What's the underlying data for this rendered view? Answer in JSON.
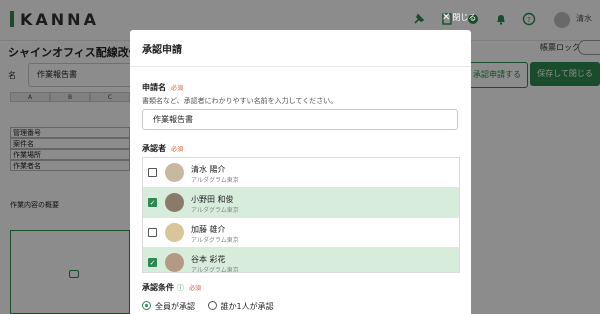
{
  "app": {
    "logo": "KANNA",
    "user_short": "清水",
    "close_label": "閉じる"
  },
  "background": {
    "project_title": "シャインオフィス配線改修工",
    "board_lock_label": "帳票ロック",
    "name_label": "名",
    "name_value": "作業報告書",
    "approval_button": "承認申請する",
    "save_close_button": "保存して閉じる",
    "sheet_columns": [
      "A",
      "B",
      "C"
    ],
    "sheet_rows": [
      "管理番号",
      "案件名",
      "作業場所",
      "作業者名"
    ],
    "sheet_text": "作業内容の概要"
  },
  "modal": {
    "title": "承認申請",
    "request_name": {
      "label": "申請名",
      "required": "必須",
      "description": "書類名など、承認者にわかりやすい名前を入力してください。",
      "value": "作業報告書"
    },
    "approvers": {
      "label": "承認者",
      "required": "必須",
      "list": [
        {
          "name": "清水 陽介",
          "org": "アルダグラム東京",
          "checked": false,
          "avatar_color": "#c9b8a0"
        },
        {
          "name": "小野田 和俊",
          "org": "アルダグラム東京",
          "checked": true,
          "avatar_color": "#8a7a6a"
        },
        {
          "name": "加藤 雄介",
          "org": "アルダグラム東京",
          "checked": false,
          "avatar_color": "#d9c59a"
        },
        {
          "name": "谷本 彩花",
          "org": "アルダグラム東京",
          "checked": true,
          "avatar_color": "#b39a86"
        }
      ]
    },
    "condition": {
      "label": "承認条件",
      "help_icon": "question-circle-icon",
      "required": "必須",
      "options": [
        {
          "label": "全員が承認",
          "selected": true
        },
        {
          "label": "誰か1人が承認",
          "selected": false
        }
      ]
    }
  },
  "colors": {
    "brand": "#2d8a4e",
    "selected_row": "#d8ecdc",
    "required": "#e05a2b"
  }
}
